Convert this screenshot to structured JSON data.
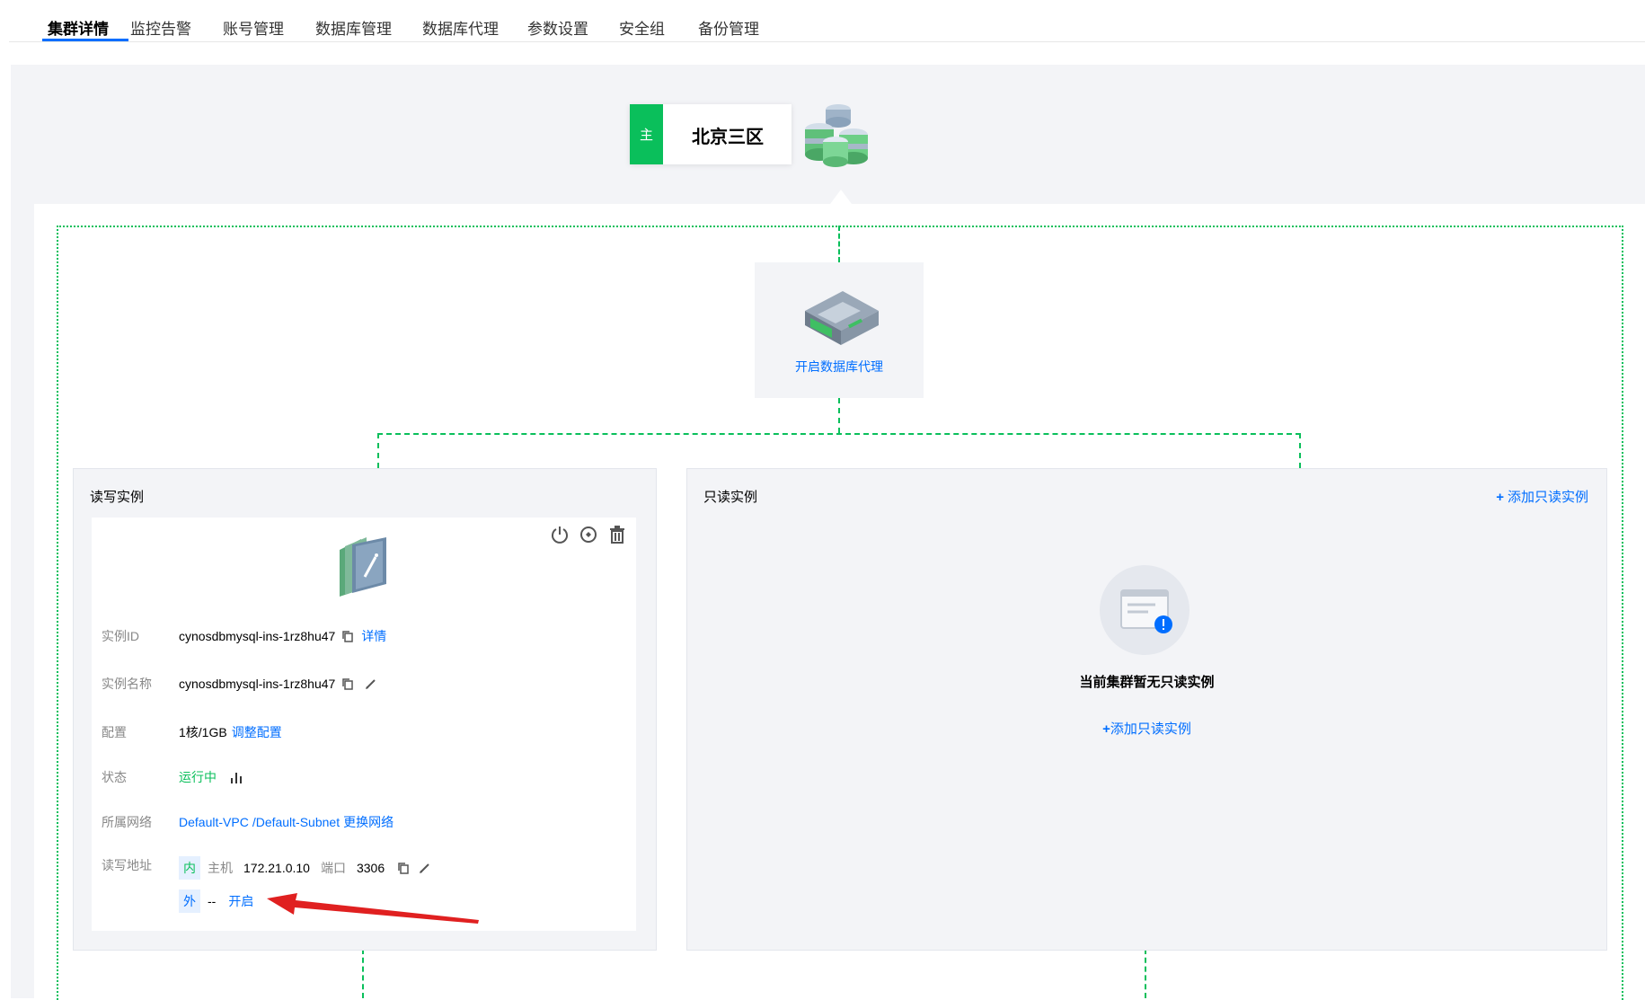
{
  "tabs": [
    {
      "label": "集群详情",
      "active": true
    },
    {
      "label": "监控告警"
    },
    {
      "label": "账号管理"
    },
    {
      "label": "数据库管理"
    },
    {
      "label": "数据库代理"
    },
    {
      "label": "参数设置"
    },
    {
      "label": "安全组"
    },
    {
      "label": "备份管理"
    }
  ],
  "region": {
    "tag": "主",
    "name": "北京三区"
  },
  "proxy": {
    "link": "开启数据库代理"
  },
  "rw_panel": {
    "title": "读写实例",
    "instance": {
      "id_label": "实例ID",
      "id": "cynosdbmysql-ins-1rz8hu47",
      "detail_link": "详情",
      "name_label": "实例名称",
      "name": "cynosdbmysql-ins-1rz8hu47",
      "config_label": "配置",
      "config": "1核/1GB",
      "adjust_link": "调整配置",
      "status_label": "状态",
      "status": "运行中",
      "network_label": "所属网络",
      "vpc": "Default-VPC",
      "subnet": "/Default-Subnet",
      "change_network_link": "更换网络",
      "address_label": "读写地址",
      "internal_tag": "内",
      "host_label": "主机",
      "host": "172.21.0.10",
      "port_label": "端口",
      "port": "3306",
      "external_tag": "外",
      "external_value": "--",
      "enable_link": "开启"
    }
  },
  "ro_panel": {
    "title": "只读实例",
    "add_top": "添加只读实例",
    "empty_text": "当前集群暂无只读实例",
    "add_mid": "添加只读实例"
  },
  "colors": {
    "accent": "#006eff",
    "success": "#0abf5b",
    "arrow": "#e02020"
  }
}
